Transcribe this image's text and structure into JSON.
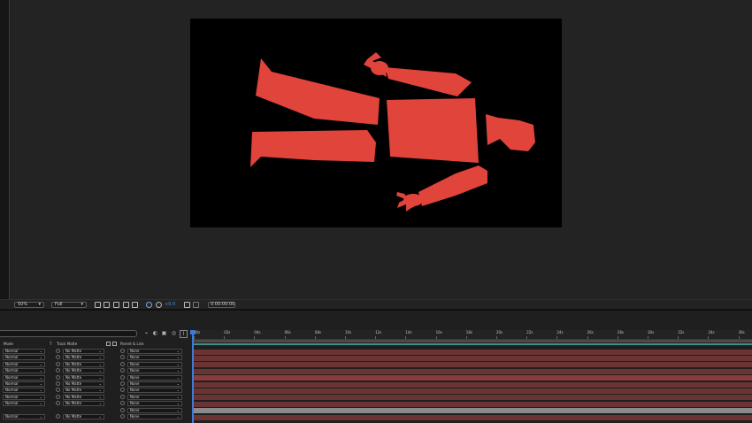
{
  "viewer": {
    "zoom": "50%",
    "resolution": "Full",
    "exposure": "+0.0",
    "timecode": "0:00:00:00"
  },
  "timeline": {
    "headers": {
      "mode": "Mode",
      "t": "T",
      "track_matte": "Track Matte",
      "parent": "Parent & Link"
    },
    "ruler": [
      "00s",
      "02s",
      "04s",
      "06s",
      "08s",
      "10s",
      "12s",
      "14s",
      "16s",
      "18s",
      "20s",
      "22s",
      "24s",
      "26s",
      "28s",
      "30s",
      "32s",
      "34s",
      "36s"
    ],
    "layers": [
      {
        "mode": "Normal",
        "matte": "No Matte",
        "parent": "None",
        "color": "#6b3434"
      },
      {
        "mode": "Normal",
        "matte": "No Matte",
        "parent": "None",
        "color": "#6b3434"
      },
      {
        "mode": "Normal",
        "matte": "No Matte",
        "parent": "None",
        "color": "#6b3434"
      },
      {
        "mode": "Normal",
        "matte": "No Matte",
        "parent": "None",
        "color": "#6b3434"
      },
      {
        "mode": "Normal",
        "matte": "No Matte",
        "parent": "None",
        "color": "#8a3c3c"
      },
      {
        "mode": "Normal",
        "matte": "No Matte",
        "parent": "None",
        "color": "#6b3434"
      },
      {
        "mode": "Normal",
        "matte": "No Matte",
        "parent": "None",
        "color": "#6b3434"
      },
      {
        "mode": "Normal",
        "matte": "No Matte",
        "parent": "None",
        "color": "#6b3434"
      },
      {
        "mode": "Normal",
        "matte": "No Matte",
        "parent": "None",
        "color": "#6b3434"
      },
      {
        "mode": "",
        "matte": "",
        "parent": "None",
        "color": "#6b3434"
      },
      {
        "mode": "Normal",
        "matte": "No Matte",
        "parent": "None",
        "color": "#6b3434"
      }
    ]
  },
  "colors": {
    "figure_red": "#e0443b",
    "track_blue": "#3d7bd6",
    "track_teal": "#3f8f8a",
    "track_gray": "#8a8a8a"
  }
}
